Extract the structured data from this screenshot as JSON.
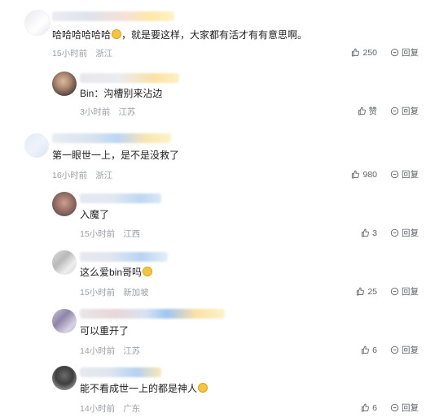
{
  "labels": {
    "reply": "回复",
    "like": "赞"
  },
  "comments": [
    {
      "text": "哈哈哈哈哈哈",
      "text2": "，就是要这样，大家都有活才有有意思啊。",
      "time": "15小时前",
      "location": "浙江",
      "likes": "250"
    },
    {
      "text": "Bin：沟槽别来沾边",
      "time": "3小时前",
      "location": "江苏",
      "likes": "赞"
    },
    {
      "text": "第一眼世一上，是不是没救了",
      "time": "16小时前",
      "location": "浙江",
      "likes": "980"
    },
    {
      "text": "入魔了",
      "time": "15小时前",
      "location": "江西",
      "likes": "3"
    },
    {
      "text": "这么爱bin哥吗",
      "time": "15小时前",
      "location": "新加坡",
      "likes": "25"
    },
    {
      "text": "可以重开了",
      "time": "14小时前",
      "location": "江苏",
      "likes": "6"
    },
    {
      "text": "能不看成世一上的都是神人",
      "time": "14小时前",
      "location": "广东",
      "likes": "6"
    }
  ]
}
